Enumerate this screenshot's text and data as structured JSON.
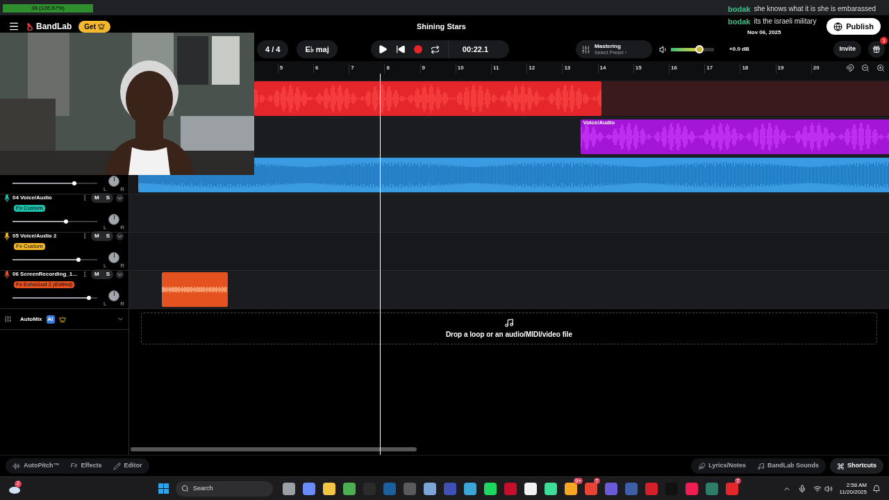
{
  "stream_overlay": {
    "goal": "38 (126.67%)"
  },
  "header": {
    "brand": "BandLab",
    "get_button": "Get",
    "title": "Shining Stars",
    "publish_button": "Publish"
  },
  "chat": [
    {
      "user": "bodak",
      "message": "she knows what it is she is embarassed"
    },
    {
      "user": "bodak",
      "message": "its the israeli military"
    }
  ],
  "chat_date": "Nov 06, 2025",
  "toolbar": {
    "time_signature": "4 / 4",
    "key": "E♭ maj",
    "time": "00:22.1",
    "mastering_title": "Mastering",
    "mastering_preset": "Select Preset ›",
    "master_volume": {
      "level": 0.66
    },
    "gain": "+0.0 dB",
    "invite": "Invite",
    "gift_badge": "3"
  },
  "ruler": [
    "5",
    "6",
    "7",
    "8",
    "9",
    "10",
    "11",
    "12",
    "13",
    "14",
    "15",
    "16",
    "17",
    "18",
    "19",
    "20"
  ],
  "tracks": [
    {
      "color": "#e5262b"
    },
    {
      "color": "#a416d6",
      "clip_label": "Voice/Audio"
    },
    {
      "color": "#3a9be3",
      "volume": {
        "level": 0.73
      },
      "pan": {
        "left": "L",
        "right": "R"
      }
    },
    {
      "number": "04",
      "name": "Voice/Audio",
      "mute": "M",
      "solo": "S",
      "fx": "Fx Custom",
      "color": "#1cbfa9",
      "volume": {
        "level": 0.63
      },
      "pan": {
        "left": "L",
        "right": "R"
      }
    },
    {
      "number": "05",
      "name": "Voice/Audio 2",
      "mute": "M",
      "solo": "S",
      "fx": "Fx Custom",
      "color": "#f1b52c",
      "volume": {
        "level": 0.78
      },
      "pan": {
        "left": "L",
        "right": "R"
      }
    },
    {
      "number": "06",
      "name": "ScreenRecording_1...",
      "mute": "M",
      "solo": "S",
      "fx": "Fx EchoGod 2 *(Edited)*",
      "color": "#e4531f",
      "volume": {
        "level": 0.9
      },
      "pan": {
        "left": "L",
        "right": "R"
      }
    }
  ],
  "automix": {
    "label": "AutoMix",
    "badge": "AI"
  },
  "drop_zone": "Drop a loop or an audio/MIDI/video file",
  "bottom_left": [
    {
      "kind": "autopitch",
      "label": "AutoPitch™"
    },
    {
      "kind": "effects",
      "icon_text": "Fx",
      "label": "Effects"
    },
    {
      "kind": "editor",
      "label": "Editor"
    }
  ],
  "bottom_right": [
    {
      "kind": "lyrics",
      "label": "Lyrics/Notes"
    },
    {
      "kind": "sounds",
      "label": "BandLab Sounds"
    },
    {
      "kind": "shortcuts",
      "label": "Shortcuts"
    }
  ],
  "taskbar": {
    "weather_badge": "2",
    "search": "Search",
    "time": "2:58 AM",
    "date": "11/20/2025",
    "apps": [
      {
        "color": "#9aa0a6"
      },
      {
        "color": "#6a8cff"
      },
      {
        "color": "#f3c544"
      },
      {
        "color": "#4caf50"
      },
      {
        "color": "#2b2b2b"
      },
      {
        "color": "#1b5f9e"
      },
      {
        "color": "#5a5a5a"
      },
      {
        "color": "#7aa5d6"
      },
      {
        "color": "#3f51b5"
      },
      {
        "color": "#3aa7d8"
      },
      {
        "color": "#1ed760"
      },
      {
        "color": "#c4102a"
      },
      {
        "color": "#f2f2f2"
      },
      {
        "color": "#3ddc97"
      },
      {
        "color": "#f5a623",
        "badge": "9+"
      },
      {
        "color": "#e84335",
        "badge": "T"
      },
      {
        "color": "#6b5bd6"
      },
      {
        "color": "#3e5fa8"
      },
      {
        "color": "#d3202a"
      },
      {
        "color": "#111111"
      },
      {
        "color": "#ee1d52"
      },
      {
        "color": "#2e7d6b"
      },
      {
        "color": "#e4262b",
        "badge": "T"
      }
    ]
  }
}
